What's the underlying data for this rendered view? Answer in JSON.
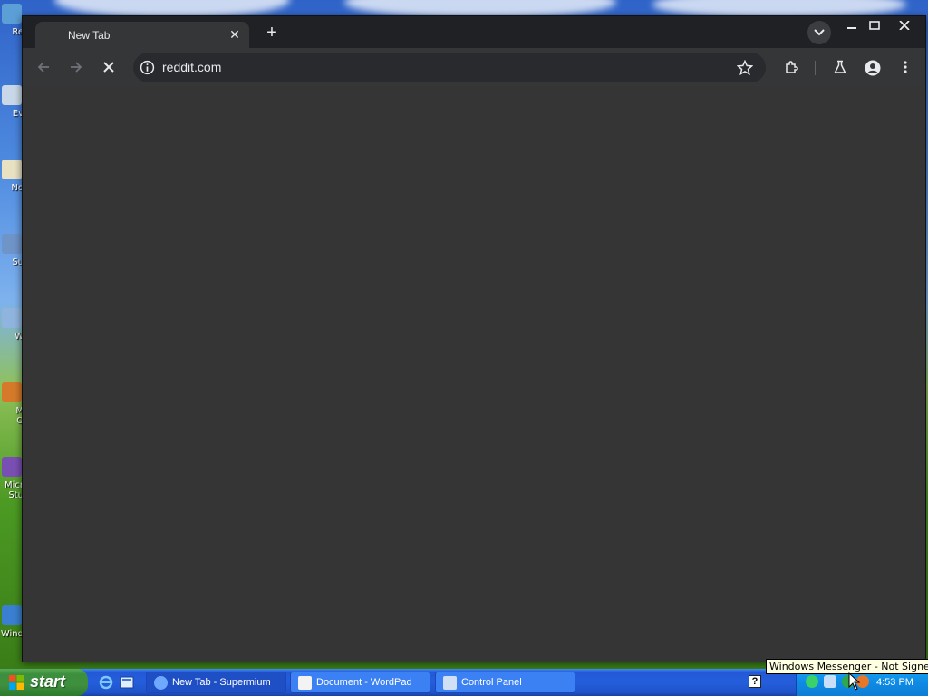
{
  "browser": {
    "tab": {
      "title": "New Tab",
      "close_glyph": "✕"
    },
    "new_tab_glyph": "+",
    "address": "reddit.com",
    "icons": [
      "back-icon",
      "forward-icon",
      "stop-icon",
      "site-info-icon",
      "star-icon",
      "extensions-icon",
      "labs-icon",
      "profile-icon",
      "menu-icon",
      "tab-search-icon",
      "minimize-icon",
      "maximize-icon",
      "close-icon"
    ]
  },
  "desktop": {
    "icon_labels": [
      "Re",
      "Ev",
      "No",
      "Su",
      "W",
      "M",
      "O",
      "Micr",
      "Stu",
      "Wind"
    ]
  },
  "taskbar": {
    "start_label": "start",
    "tasks": [
      {
        "label": "New Tab - Supermium"
      },
      {
        "label": "Document - WordPad"
      },
      {
        "label": "Control Panel"
      }
    ],
    "help_glyph": "?",
    "clock": "4:53 PM",
    "tooltip": "Windows Messenger - Not Signed In"
  },
  "colors": {
    "browser_frame": "#202124",
    "toolbar": "#353638",
    "content": "#353535",
    "taskbar": "#245edb",
    "start_button": "#3c8f3c"
  }
}
